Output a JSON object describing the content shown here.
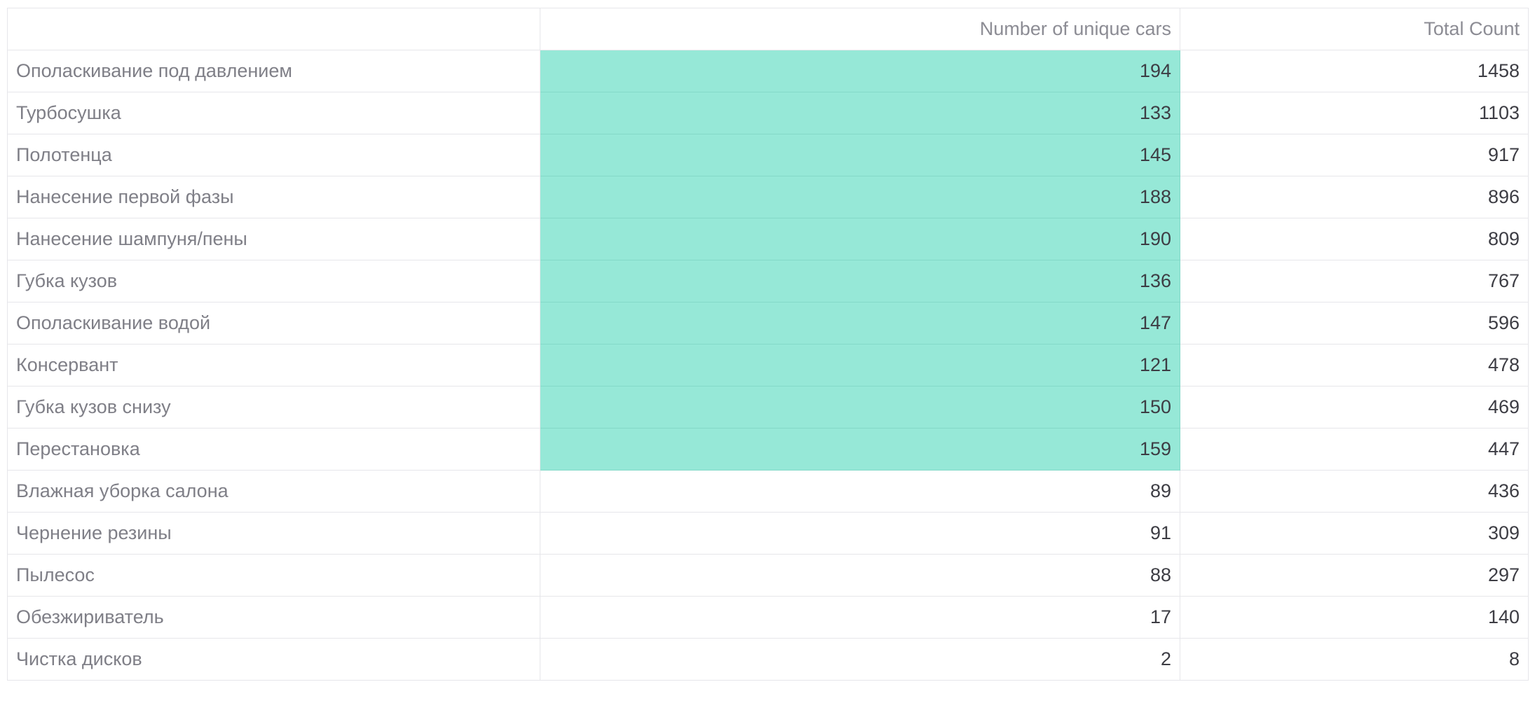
{
  "table": {
    "columns": [
      "",
      "Number of unique cars",
      "Total Count"
    ],
    "rows": [
      {
        "name": "Ополаскивание под давлением",
        "unique": "194",
        "total": "1458",
        "highlight": true
      },
      {
        "name": "Турбосушка",
        "unique": "133",
        "total": "1103",
        "highlight": true
      },
      {
        "name": "Полотенца",
        "unique": "145",
        "total": "917",
        "highlight": true
      },
      {
        "name": "Нанесение первой фазы",
        "unique": "188",
        "total": "896",
        "highlight": true
      },
      {
        "name": "Нанесение шампуня/пены",
        "unique": "190",
        "total": "809",
        "highlight": true
      },
      {
        "name": "Губка кузов",
        "unique": "136",
        "total": "767",
        "highlight": true
      },
      {
        "name": "Ополаскивание водой",
        "unique": "147",
        "total": "596",
        "highlight": true
      },
      {
        "name": "Консервант",
        "unique": "121",
        "total": "478",
        "highlight": true
      },
      {
        "name": "Губка кузов снизу",
        "unique": "150",
        "total": "469",
        "highlight": true
      },
      {
        "name": "Перестановка",
        "unique": "159",
        "total": "447",
        "highlight": true
      },
      {
        "name": "Влажная уборка салона",
        "unique": "89",
        "total": "436",
        "highlight": false
      },
      {
        "name": "Чернение резины",
        "unique": "91",
        "total": "309",
        "highlight": false
      },
      {
        "name": "Пылесос",
        "unique": "88",
        "total": "297",
        "highlight": false
      },
      {
        "name": "Обезжириватель",
        "unique": "17",
        "total": "140",
        "highlight": false
      },
      {
        "name": "Чистка дисков",
        "unique": "2",
        "total": "8",
        "highlight": false
      }
    ]
  },
  "colors": {
    "highlight": "#96e8d7",
    "border": "#e6e6ea",
    "label_text": "#7f7f87",
    "value_text": "#3d3d44"
  }
}
